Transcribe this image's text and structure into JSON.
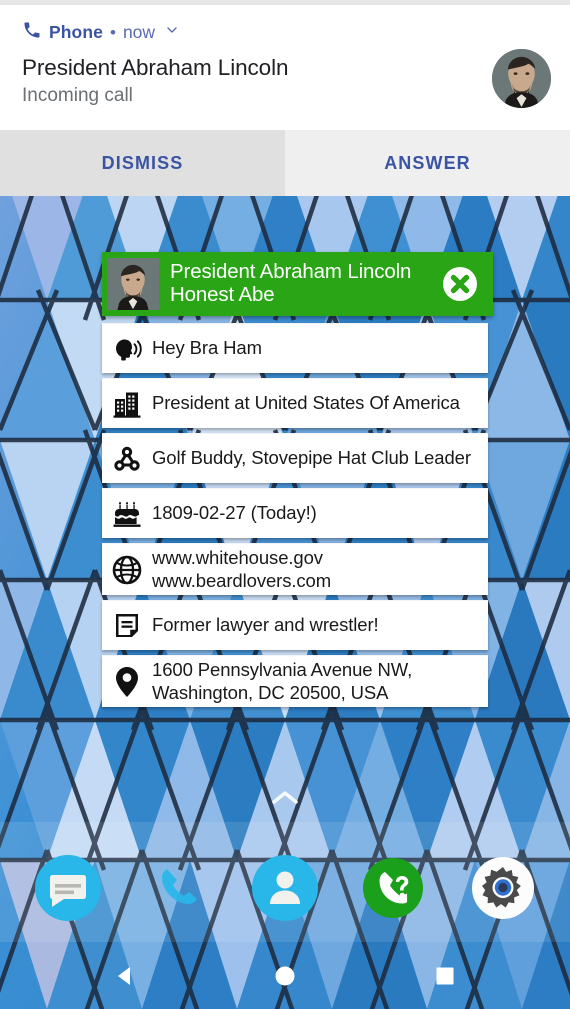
{
  "notification": {
    "app_icon": "phone-icon",
    "app_name": "Phone",
    "separator": "•",
    "time": "now",
    "expand_icon": "chevron-down-icon",
    "title": "President Abraham Lincoln",
    "subtitle": "Incoming call",
    "avatar_icon": "contact-photo-lincoln",
    "actions": [
      {
        "label": "DISMISS",
        "name": "dismiss-button"
      },
      {
        "label": "ANSWER",
        "name": "answer-button"
      }
    ]
  },
  "contact_card": {
    "header": {
      "avatar_icon": "contact-photo-lincoln",
      "name": "President Abraham Lincoln",
      "nickname": "Honest Abe",
      "close_icon": "close-icon",
      "background_color": "#2aa515"
    },
    "rows": [
      {
        "icon": "speaking-head-icon",
        "name": "row-nickname-pronunciation",
        "line1": "Hey Bra Ham",
        "line2": ""
      },
      {
        "icon": "building-icon",
        "name": "row-organization",
        "line1": "President at United States Of America",
        "line2": ""
      },
      {
        "icon": "relationship-icon",
        "name": "row-relationship",
        "line1": "Golf Buddy, Stovepipe Hat Club Leader",
        "line2": ""
      },
      {
        "icon": "birthday-cake-icon",
        "name": "row-birthday",
        "line1": "1809-02-27 (Today!)",
        "line2": ""
      },
      {
        "icon": "globe-icon",
        "name": "row-websites",
        "line1": "www.whitehouse.gov",
        "line2": "www.beardlovers.com"
      },
      {
        "icon": "note-icon",
        "name": "row-note",
        "line1": "Former lawyer and wrestler!",
        "line2": ""
      },
      {
        "icon": "location-pin-icon",
        "name": "row-address",
        "line1": "1600 Pennsylvania Avenue NW,",
        "line2": "Washington, DC 20500, USA"
      }
    ]
  },
  "home_screen": {
    "page_indicator_icon": "chevron-up-icon",
    "dock": [
      {
        "name": "dock-messages",
        "icon": "messages-icon",
        "color": "#29b6e8"
      },
      {
        "name": "dock-phone",
        "icon": "phone-icon",
        "color": "#29b6e8"
      },
      {
        "name": "dock-contacts",
        "icon": "contacts-icon",
        "color": "#29b6e8"
      },
      {
        "name": "dock-caller-id",
        "icon": "caller-id-icon",
        "color": "#1aa01a"
      },
      {
        "name": "dock-settings",
        "icon": "settings-gear-icon",
        "color": "#ffffff"
      }
    ]
  },
  "navigation_bar": {
    "back_icon": "back-triangle-icon",
    "home_icon": "home-circle-icon",
    "recents_icon": "recents-square-icon"
  },
  "colors": {
    "accent_blue": "#3b53a4",
    "green": "#2aa515",
    "wallpaper_blue": "#3d8fd0"
  }
}
